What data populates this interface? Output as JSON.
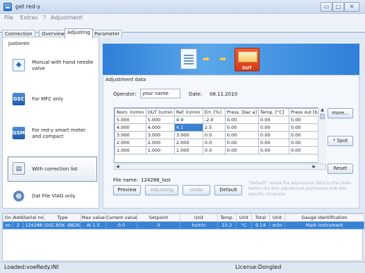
{
  "window": {
    "title": "get red-y"
  },
  "menu": [
    "File",
    "Extras",
    "?",
    "Adjustment"
  ],
  "tabs": [
    "Connection",
    "Overview",
    "Adjusting",
    "Parameter"
  ],
  "active_tab": "Adjusting",
  "left_panel": {
    "group_label": "Justieren",
    "modes": [
      {
        "label": "Manual with hand needle valve",
        "icon": "valve-icon",
        "glyph": "⛖"
      },
      {
        "label": "For MFC only",
        "icon": "gsc-icon",
        "glyph": "GSC"
      },
      {
        "label": "For red-y smart meter and compact",
        "icon": "gsm-icon",
        "glyph": "GSM"
      },
      {
        "label": "With correction list",
        "icon": "list-icon",
        "glyph": "▤"
      },
      {
        "label": "Dat File VIAG only",
        "icon": "gear-icon",
        "glyph": ""
      }
    ],
    "active_mode": "With correction list"
  },
  "banner": {
    "dut_label": "DUT"
  },
  "adjustment": {
    "title": "Adjustment data",
    "operator_label": "Operator:",
    "operator_value": "your name",
    "date_label": "Date:",
    "date_value": "08.11.2010",
    "columns": [
      "Nom. ln/min",
      "DUT ln/min",
      "Ref. ln/min",
      "Err. [%]",
      "Press. [bar a]",
      "Temp. [°C]",
      "Press out [ba"
    ],
    "rows": [
      [
        "5.000",
        "5.000",
        "4.9",
        "-2.0",
        "0.00",
        "0.00",
        "0.00"
      ],
      [
        "4.000",
        "4.000",
        "4.1",
        "2.5",
        "0.00",
        "0.00",
        "0.00"
      ],
      [
        "3.000",
        "3.000",
        "3.000",
        "0.0",
        "0.00",
        "0.00",
        "0.00"
      ],
      [
        "2.000",
        "2.000",
        "2.000",
        "0.0",
        "0.00",
        "0.00",
        "0.00"
      ],
      [
        "1.000",
        "1.000",
        "1.000",
        "0.0",
        "0.00",
        "0.00",
        "0.00"
      ]
    ],
    "file_name_label": "File name:",
    "file_name_value": "124288_last",
    "buttons": {
      "more": "more...",
      "spot": "* Spot",
      "reset": "Reset",
      "preview": "Preview",
      "adjusting": "Adjusting",
      "undo": "Undo",
      "default": "Default"
    },
    "default_note": "\"Default\" resets the adjustment data to the state before the first adjustment performed with this specific computer."
  },
  "devices": {
    "columns": [
      "On",
      "Addr",
      "Serial no.",
      "Type",
      "Max value",
      "Current value",
      "Setpoint",
      "Unit",
      "Temp.",
      "Unit",
      "Total",
      "Unit",
      "Gauge identification"
    ],
    "rows": [
      [
        "on",
        "2",
        "124288",
        "GSC-B5K -BB26",
        "Ai 1 5",
        "0.0",
        "0",
        "ln/min",
        "23.2",
        "°C",
        "0.14",
        "m3n",
        "Mark Instrument"
      ]
    ]
  },
  "status": {
    "left": "Loaded:voeRedy.INI",
    "right": "License:Dongled"
  }
}
